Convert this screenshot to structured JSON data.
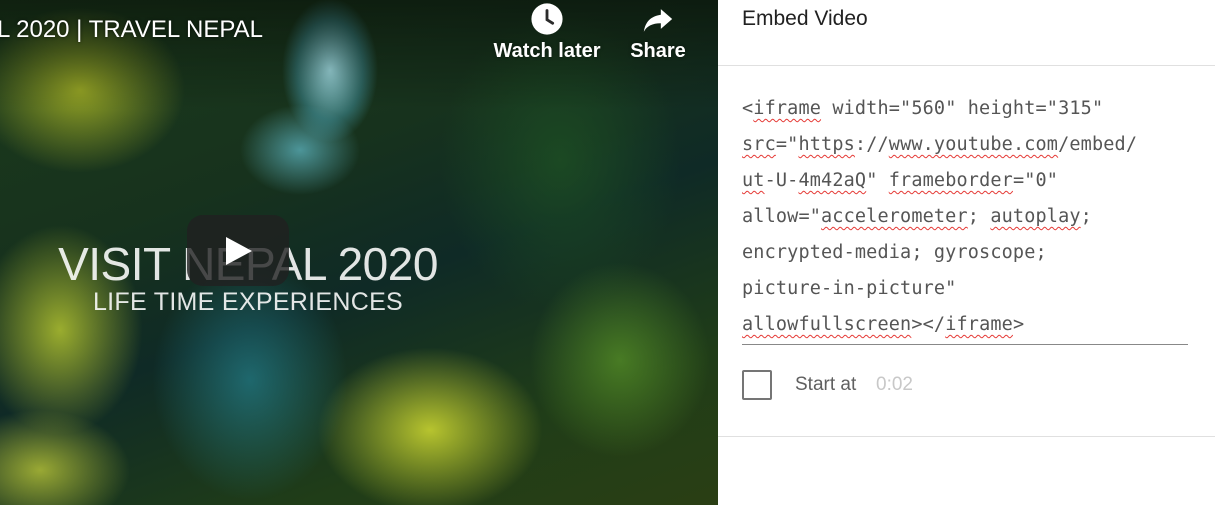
{
  "video": {
    "title": "L 2020 | TRAVEL NEPAL",
    "watch_later_label": "Watch later",
    "share_label": "Share",
    "overlay_headline": "VISIT NEPAL 2020",
    "overlay_subheadline": "LIFE TIME EXPERIENCES",
    "icons": {
      "watch_later": "clock-icon",
      "share": "share-arrow-icon",
      "play": "play-icon"
    }
  },
  "embed": {
    "title": "Embed Video",
    "code_lines": [
      [
        {
          "t": "<"
        },
        {
          "t": "iframe",
          "sp": true
        },
        {
          "t": " width=\"560\" height=\"315\""
        }
      ],
      [
        {
          "t": "src",
          "sp": true
        },
        {
          "t": "=\""
        },
        {
          "t": "https",
          "sp": true
        },
        {
          "t": "://"
        },
        {
          "t": "www.youtube.com",
          "sp": true
        },
        {
          "t": "/embed/"
        }
      ],
      [
        {
          "t": "ut",
          "sp": true
        },
        {
          "t": "-U-"
        },
        {
          "t": "4m42aQ",
          "sp": true
        },
        {
          "t": "\" "
        },
        {
          "t": "frameborder",
          "sp": true
        },
        {
          "t": "=\"0\""
        }
      ],
      [
        {
          "t": "allow=\""
        },
        {
          "t": "accelerometer",
          "sp": true
        },
        {
          "t": "; "
        },
        {
          "t": "autoplay",
          "sp": true
        },
        {
          "t": ";"
        }
      ],
      [
        {
          "t": "encrypted-media; gyroscope;"
        }
      ],
      [
        {
          "t": "picture-in-picture\""
        }
      ],
      [
        {
          "t": "allowfullscreen",
          "sp": true
        },
        {
          "t": "></"
        },
        {
          "t": "iframe",
          "sp": true
        },
        {
          "t": ">"
        }
      ]
    ],
    "start_at_label": "Start at",
    "start_at_value": "0:02",
    "start_at_checked": false
  },
  "colors": {
    "text_primary": "#212121",
    "code_text": "#555555",
    "spellcheck_red": "#e53935",
    "divider": "#e0e0e0"
  }
}
